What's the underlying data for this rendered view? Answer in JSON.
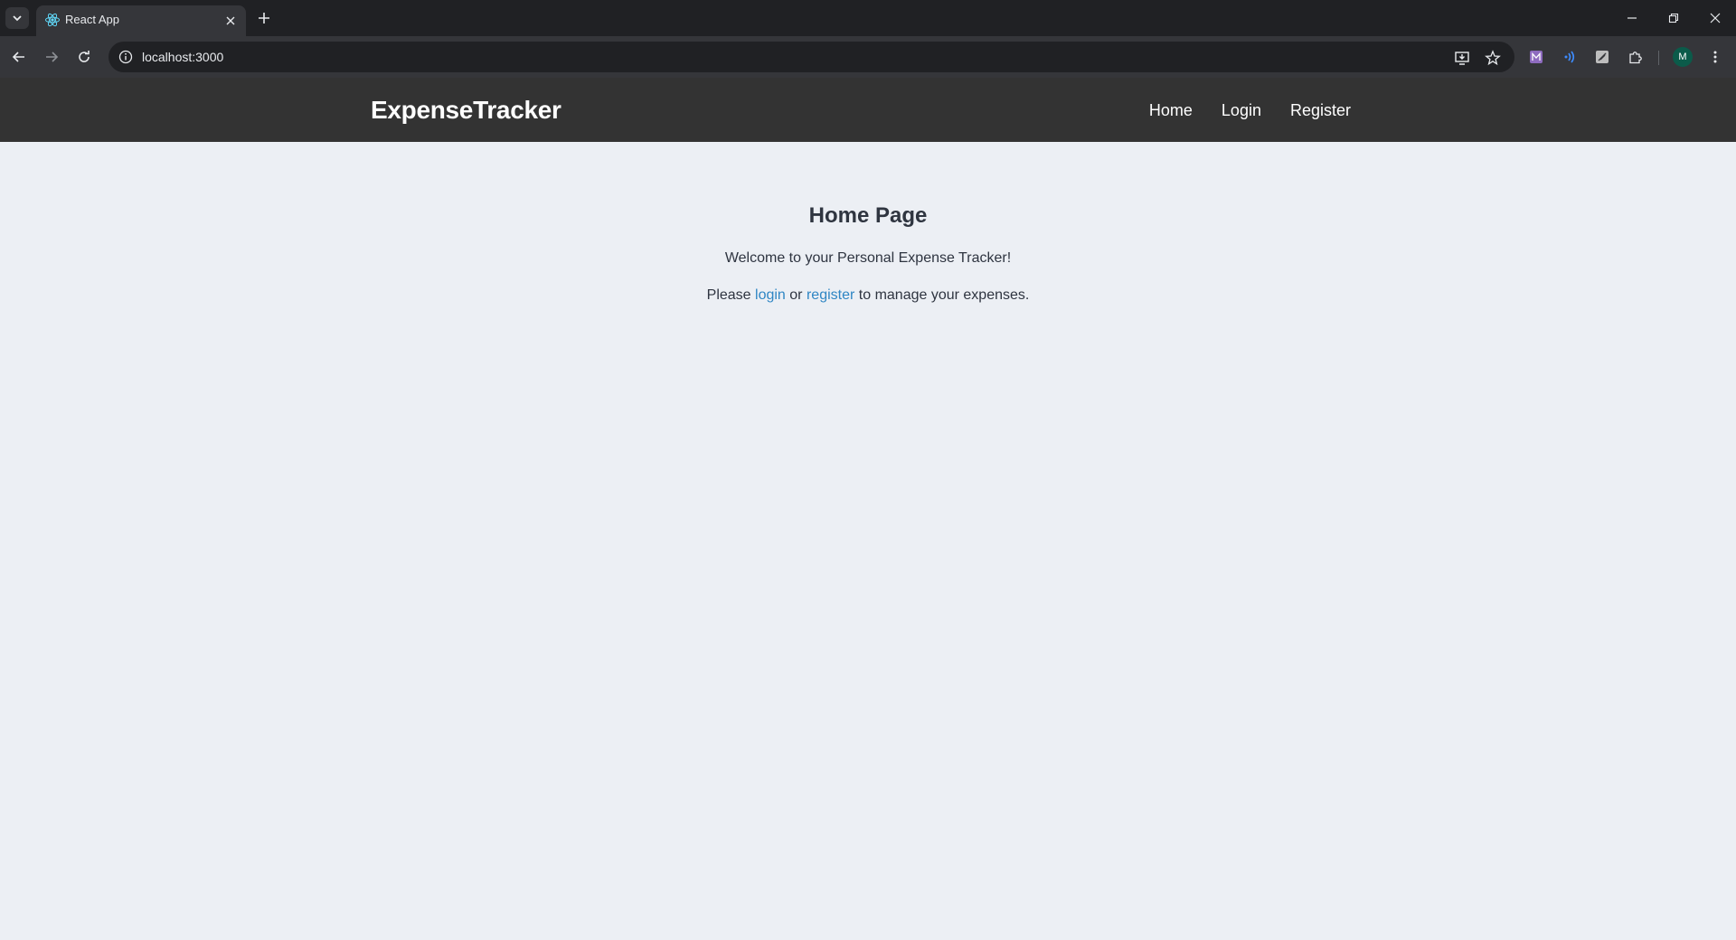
{
  "browser": {
    "tab_title": "React App",
    "url": "localhost:3000",
    "avatar_initial": "M",
    "icons": [
      "tab-search-icon",
      "react-favicon-icon",
      "close-icon",
      "plus-icon",
      "minimize-icon",
      "restore-icon",
      "window-close-icon",
      "back-arrow-icon",
      "forward-arrow-icon",
      "reload-icon",
      "info-icon",
      "install-app-icon",
      "star-icon",
      "extension-m-icon",
      "extension-waves-icon",
      "extension-feather-icon",
      "puzzle-icon",
      "kebab-menu-icon"
    ]
  },
  "app": {
    "brand": "ExpenseTracker",
    "nav": {
      "home": "Home",
      "login": "Login",
      "register": "Register"
    },
    "main": {
      "title": "Home Page",
      "welcome": "Welcome to your Personal Expense Tracker!",
      "cta_prefix": "Please",
      "cta_login": "login",
      "cta_or": "or",
      "cta_register": "register",
      "cta_suffix": "to manage your expenses."
    }
  },
  "colors": {
    "nav_bg": "#333333",
    "page_bg": "#eceff4",
    "link": "#2f86c4",
    "text": "#2e3440"
  }
}
